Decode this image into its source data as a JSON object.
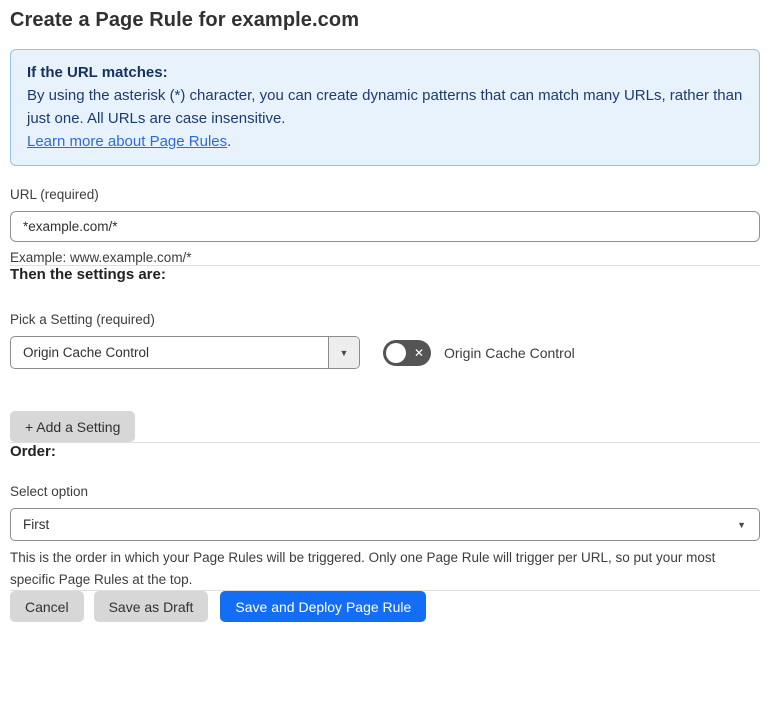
{
  "page": {
    "title": "Create a Page Rule for example.com"
  },
  "info_box": {
    "heading": "If the URL matches:",
    "body": "By using the asterisk (*) character, you can create dynamic patterns that can match many URLs, rather than just one. All URLs are case insensitive.",
    "link": "Learn more about Page Rules",
    "link_suffix": "."
  },
  "url_field": {
    "label": "URL (required)",
    "value": "*example.com/*",
    "example": "Example: www.example.com/*"
  },
  "settings": {
    "heading": "Then the settings are:",
    "picker_label": "Pick a Setting (required)",
    "picker_value": "Origin Cache Control",
    "toggle_label": "Origin Cache Control",
    "toggle_state": "off",
    "add_button_label": "+ Add a Setting"
  },
  "order": {
    "heading": "Order:",
    "label": "Select option",
    "value": "First",
    "help": "This is the order in which your Page Rules will be triggered. Only one Page Rule will trigger per URL, so put your most specific Page Rules at the top."
  },
  "footer": {
    "cancel_label": "Cancel",
    "save_draft_label": "Save as Draft",
    "save_deploy_label": "Save and Deploy Page Rule"
  },
  "icons": {
    "caret_down": "▼",
    "toggle_off_x": "✕"
  },
  "colors": {
    "accent_blue": "#146ef5",
    "info_bg": "#e8f2fc",
    "info_border": "#93c2eb",
    "info_text": "#1d3c6e",
    "link_blue": "#2c6cd8",
    "toggle_off_bg": "#545454",
    "button_gray": "#d7d7d7"
  }
}
